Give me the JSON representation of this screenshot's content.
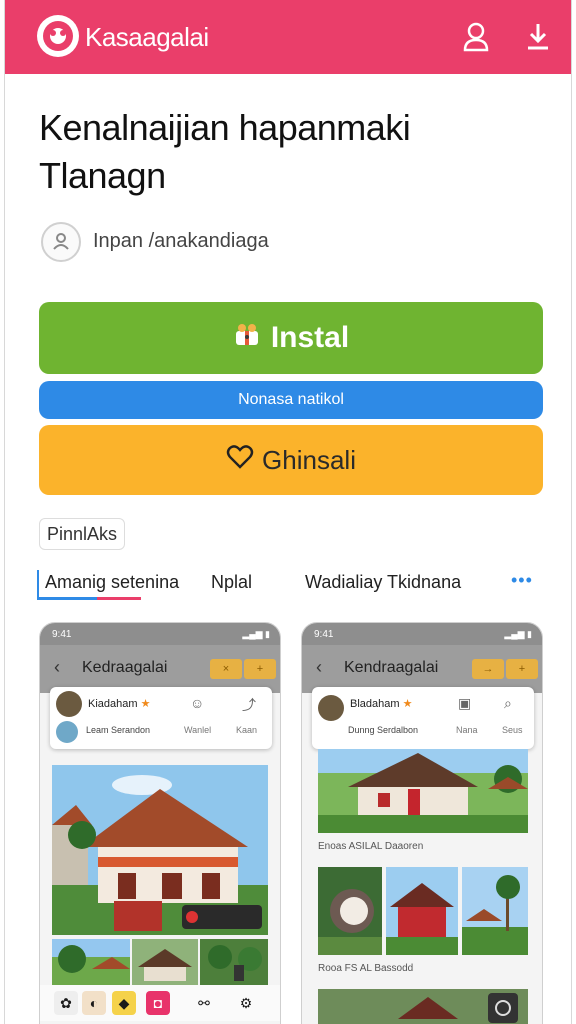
{
  "header": {
    "brand": "Kasaagalai",
    "profile_icon": "user-icon",
    "download_icon": "download-icon",
    "bg_color": "#ea3e6a"
  },
  "page": {
    "title_line1": "Kenalnaijian hapanmaki",
    "title_line2": "Tlanagn",
    "author": "Inpan /anakandiaga"
  },
  "actions": {
    "install_label": "Instal",
    "install_color": "#6fb431",
    "blue_label": "Nonasa natikol",
    "blue_color": "#2e8ae6",
    "yellow_label": "Ghinsali",
    "yellow_color": "#fbb32b"
  },
  "chip": {
    "label": "PinnlAks"
  },
  "tabs": [
    {
      "label": "Amanig setenina",
      "active": true
    },
    {
      "label": "Nplal",
      "active": false
    },
    {
      "label": "Wadialiay Tkidnana",
      "active": false
    }
  ],
  "tabs_more": "•••",
  "screens": [
    {
      "time": "9:41",
      "title": "Kedraagalai",
      "card_name": "Kiadaham",
      "card_sub": "Leam Serandon",
      "card_labels": [
        "Wanlel",
        "Kaan"
      ]
    },
    {
      "time": "9:41",
      "title": "Kendraagalai",
      "card_name": "Bladaham",
      "card_sub": "Dunng Serdalbon",
      "card_labels": [
        "Nana",
        "Seus"
      ],
      "section1": "Enoas ASILAL Daaoren",
      "section2": "Rooa FS AL Bassodd"
    }
  ]
}
